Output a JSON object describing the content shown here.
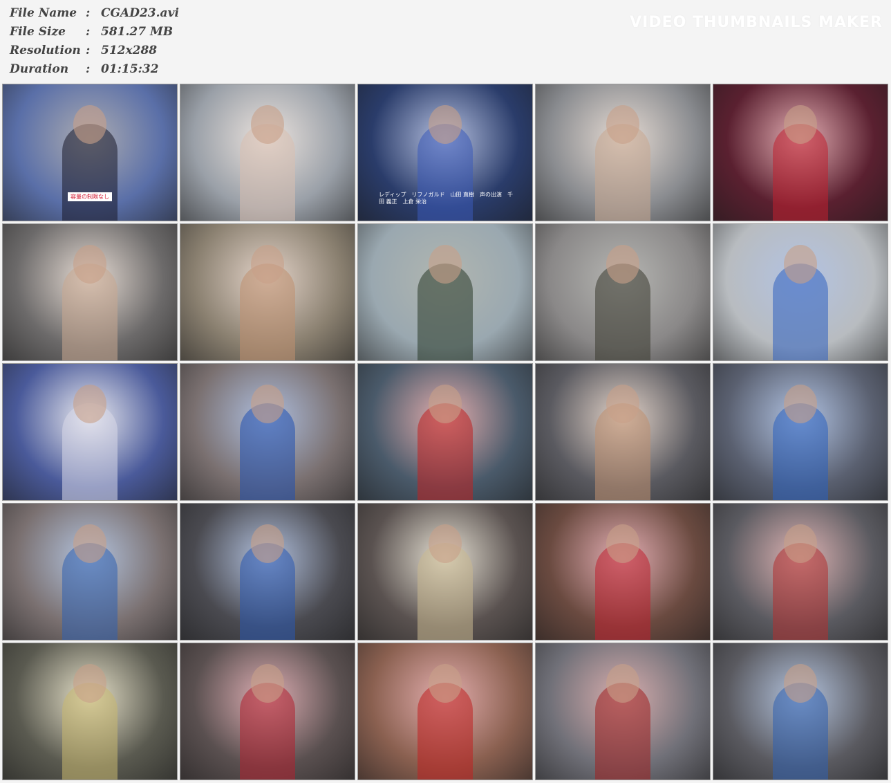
{
  "info": {
    "rows": [
      {
        "label": "File Name",
        "value": "CGAD23.avi"
      },
      {
        "label": "File Size",
        "value": "581.27 MB"
      },
      {
        "label": "Resolution",
        "value": "512x288"
      },
      {
        "label": "Duration",
        "value": "01:15:32"
      }
    ],
    "colon": ":"
  },
  "watermark": "VIDEO THUMBNAILS MAKER",
  "thumbnails": [
    {
      "bg": "#5a6fa8",
      "accent": "#1a1a2a",
      "caption": "容量の制限なし"
    },
    {
      "bg": "#9aa0a8",
      "accent": "#d8c0b0",
      "caption": ""
    },
    {
      "bg": "#2a3c6a",
      "accent": "#3a5ab8",
      "caption": "レディップ　リフノガルド　山田 直樹　声の出演　千田 義正　上倉 栄治"
    },
    {
      "bg": "#8a8c90",
      "accent": "#c8a890",
      "caption": ""
    },
    {
      "bg": "#5a2030",
      "accent": "#c02030",
      "caption": ""
    },
    {
      "bg": "#6c6a6a",
      "accent": "#c8a890",
      "caption": ""
    },
    {
      "bg": "#8a8070",
      "accent": "#c09070",
      "caption": ""
    },
    {
      "bg": "#9aa8b0",
      "accent": "#2a3a2a",
      "caption": ""
    },
    {
      "bg": "#8a8888",
      "accent": "#3a3a30",
      "caption": ""
    },
    {
      "bg": "#b8bcc0",
      "accent": "#3060c0",
      "caption": ""
    },
    {
      "bg": "#4a5a9a",
      "accent": "#d8d8e8",
      "caption": ""
    },
    {
      "bg": "#7a7070",
      "accent": "#2050b0",
      "caption": ""
    },
    {
      "bg": "#4a5a6a",
      "accent": "#c02020",
      "caption": ""
    },
    {
      "bg": "#5a5a60",
      "accent": "#c09070",
      "caption": ""
    },
    {
      "bg": "#5a6070",
      "accent": "#2a60c0",
      "caption": ""
    },
    {
      "bg": "#7a7070",
      "accent": "#3060b0",
      "caption": ""
    },
    {
      "bg": "#4a4a50",
      "accent": "#2a58b0",
      "caption": ""
    },
    {
      "bg": "#5a5250",
      "accent": "#c8b890",
      "caption": ""
    },
    {
      "bg": "#6a4a40",
      "accent": "#c02030",
      "caption": ""
    },
    {
      "bg": "#5a5a60",
      "accent": "#b03030",
      "caption": ""
    },
    {
      "bg": "#5a5a50",
      "accent": "#c8b870",
      "caption": ""
    },
    {
      "bg": "#5a5050",
      "accent": "#b02030",
      "caption": ""
    },
    {
      "bg": "#8a6050",
      "accent": "#c02020",
      "caption": ""
    },
    {
      "bg": "#707078",
      "accent": "#a02020",
      "caption": ""
    },
    {
      "bg": "#5a5a60",
      "accent": "#3060b0",
      "caption": ""
    }
  ]
}
